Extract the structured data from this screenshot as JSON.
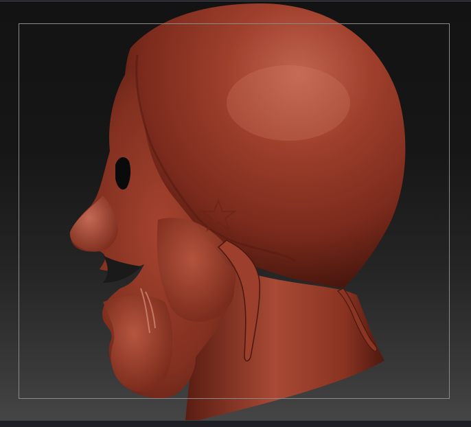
{
  "app": {
    "window": "sculpt-viewport"
  },
  "viewport": {
    "background_top": "#131313",
    "background_bottom": "#474747",
    "frame_color": "#8a8a8a"
  },
  "model": {
    "subject": "sculpted-bald-head-profile",
    "base_color": "#8e3424",
    "highlight_color": "#c86a55",
    "shadow_color": "#3c120b"
  }
}
